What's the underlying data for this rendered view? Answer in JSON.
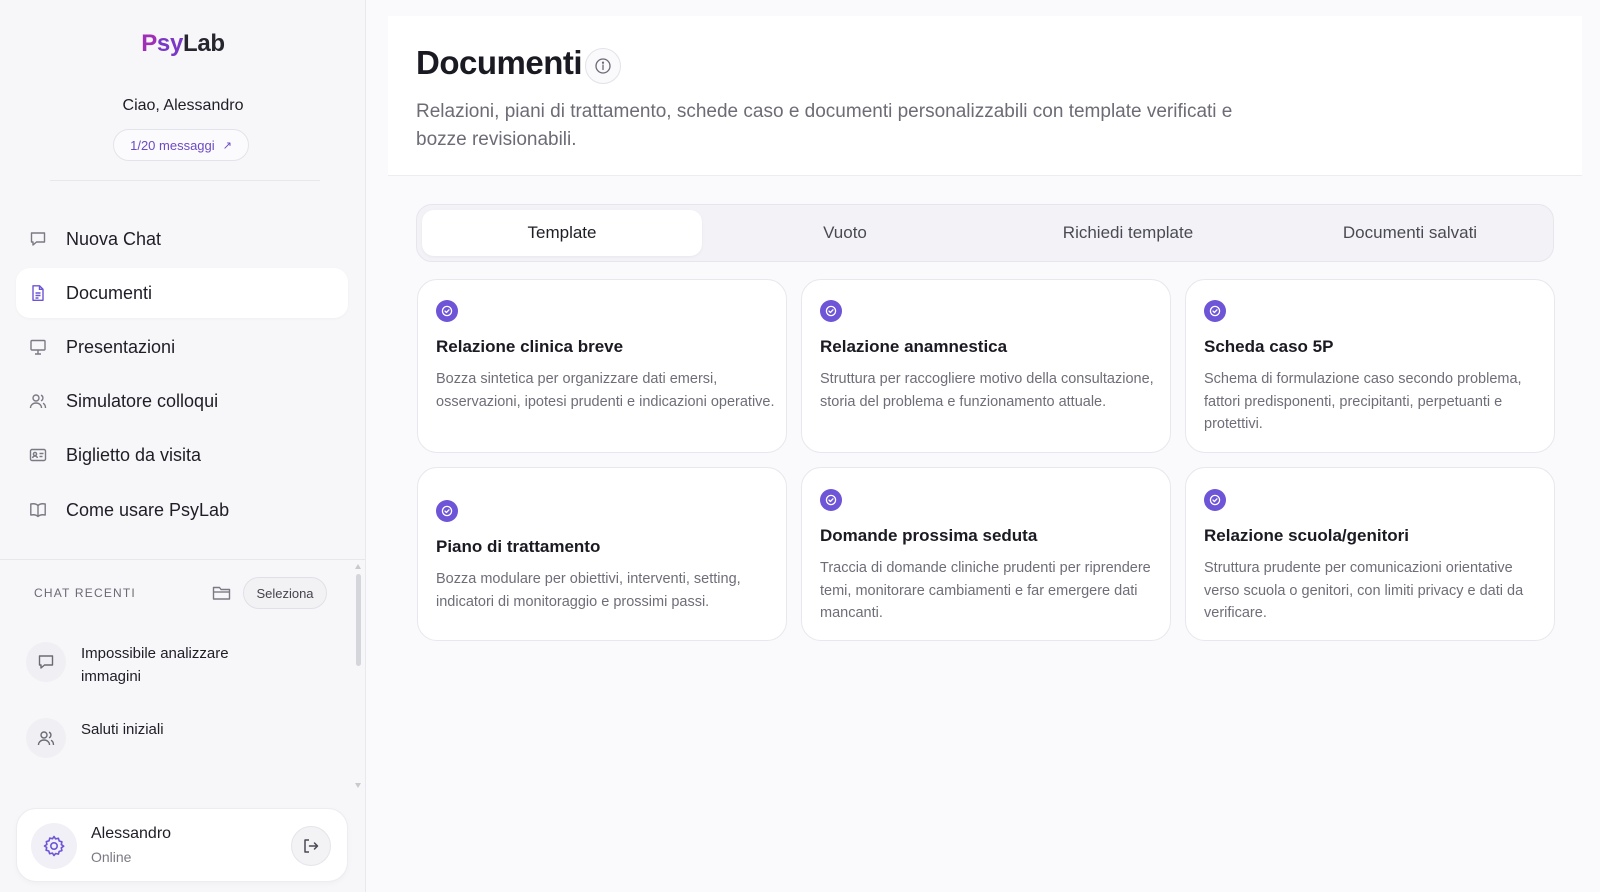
{
  "sidebar": {
    "logo": {
      "p": "P",
      "sy": "sy",
      "lab": "Lab"
    },
    "greeting": "Ciao, Alessandro",
    "messages_pill": "1/20 messaggi",
    "nav": [
      {
        "label": "Nuova Chat",
        "icon": "chat-bubble-icon"
      },
      {
        "label": "Documenti",
        "icon": "document-icon",
        "active": true
      },
      {
        "label": "Presentazioni",
        "icon": "presentation-icon"
      },
      {
        "label": "Simulatore colloqui",
        "icon": "users-icon"
      },
      {
        "label": "Biglietto da visita",
        "icon": "id-card-icon"
      },
      {
        "label": "Come usare PsyLab",
        "icon": "book-icon"
      }
    ],
    "recent": {
      "title": "CHAT RECENTI",
      "select_label": "Seleziona",
      "items": [
        {
          "label": "Impossibile analizzare immagini",
          "icon": "chat-bubble-icon"
        },
        {
          "label": "Saluti iniziali",
          "icon": "users-icon"
        }
      ]
    },
    "user": {
      "name": "Alessandro",
      "status": "Online"
    }
  },
  "main": {
    "title": "Documenti",
    "description": "Relazioni, piani di trattamento, schede caso e documenti personalizzabili con template verificati e bozze revisionabili.",
    "tabs": [
      "Template",
      "Vuoto",
      "Richiedi template",
      "Documenti salvati"
    ],
    "active_tab": "Template",
    "cards": [
      {
        "title": "Relazione clinica breve",
        "desc": "Bozza sintetica per organizzare dati emersi, osservazioni, ipotesi prudenti e indicazioni operative."
      },
      {
        "title": "Relazione anamnestica",
        "desc": "Struttura per raccogliere motivo della consultazione, storia del problema e funzionamento attuale."
      },
      {
        "title": "Scheda caso 5P",
        "desc": "Schema di formulazione caso secondo problema, fattori predisponenti, precipitanti, perpetuanti e protettivi."
      },
      {
        "title": "Piano di trattamento",
        "desc": "Bozza modulare per obiettivi, interventi, setting, indicatori di monitoraggio e prossimi passi."
      },
      {
        "title": "Domande prossima seduta",
        "desc": "Traccia di domande cliniche prudenti per riprendere temi, monitorare cambiamenti e far emergere dati mancanti."
      },
      {
        "title": "Relazione scuola/genitori",
        "desc": "Struttura prudente per comunicazioni orientative verso scuola o genitori, con limiti privacy e dati da verificare."
      }
    ]
  },
  "colors": {
    "accent": "#6e54d6",
    "logo_p": "#a02fb8",
    "logo_sy": "#7a38c7"
  }
}
